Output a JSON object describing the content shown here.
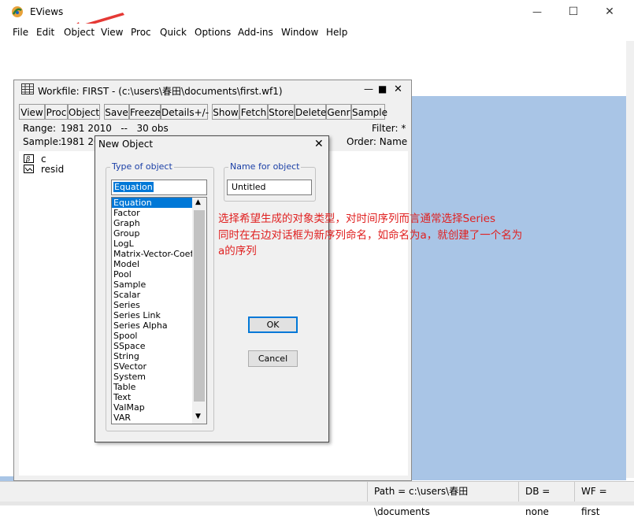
{
  "app": {
    "title": "EViews",
    "icon": "eviews-logo-icon"
  },
  "window_controls": {
    "minimize": "—",
    "maximize": "☐",
    "close": "✕"
  },
  "menu": [
    "File",
    "Edit",
    "Object",
    "View",
    "Proc",
    "Quick",
    "Options",
    "Add-ins",
    "Window",
    "Help"
  ],
  "workfile": {
    "title": "Workfile: FIRST - (c:\\users\\春田\\documents\\first.wf1)",
    "controls": {
      "minimize": "—",
      "maximize": "■",
      "close": "✕"
    },
    "toolbar": [
      "View",
      "Proc",
      "Object",
      "Save",
      "Freeze",
      "Details+/-",
      "Show",
      "Fetch",
      "Store",
      "Delete",
      "Genr",
      "Sample"
    ],
    "range_label": "Range:",
    "range_value": "1981 2010   --   30 obs",
    "sample_label": "Sample:",
    "sample_value": "1981 20",
    "filter": "Filter: *",
    "order": "Order: Name",
    "objects": [
      {
        "name": "c",
        "icon": "coefficient-icon"
      },
      {
        "name": "resid",
        "icon": "series-icon"
      }
    ]
  },
  "dialog": {
    "title": "New Object",
    "type_group_label": "Type of object",
    "type_input_value": "Equation",
    "types": [
      "Equation",
      "Factor",
      "Graph",
      "Group",
      "LogL",
      "Matrix-Vector-Coef",
      "Model",
      "Pool",
      "Sample",
      "Scalar",
      "Series",
      "Series Link",
      "Series Alpha",
      "Spool",
      "SSpace",
      "String",
      "SVector",
      "System",
      "Table",
      "Text",
      "ValMap",
      "VAR"
    ],
    "selected_type": "Equation",
    "name_group_label": "Name for object",
    "name_value": "Untitled",
    "ok_label": "OK",
    "cancel_label": "Cancel"
  },
  "annotation": {
    "line1": "选择希望生成的对象类型，对时间序列而言通常选择Series",
    "line2": "同时在右边对话框为新序列命名，如命名为a，就创建了一个名为",
    "line3": "a的序列",
    "color": "#e02020"
  },
  "statusbar": {
    "path": "Path = c:\\users\\春田\\documents",
    "db": "DB = none",
    "wf": "WF = first"
  },
  "colors": {
    "desktop": "#a9c5e6",
    "selection": "#0078d7",
    "annotation": "#e02020"
  }
}
